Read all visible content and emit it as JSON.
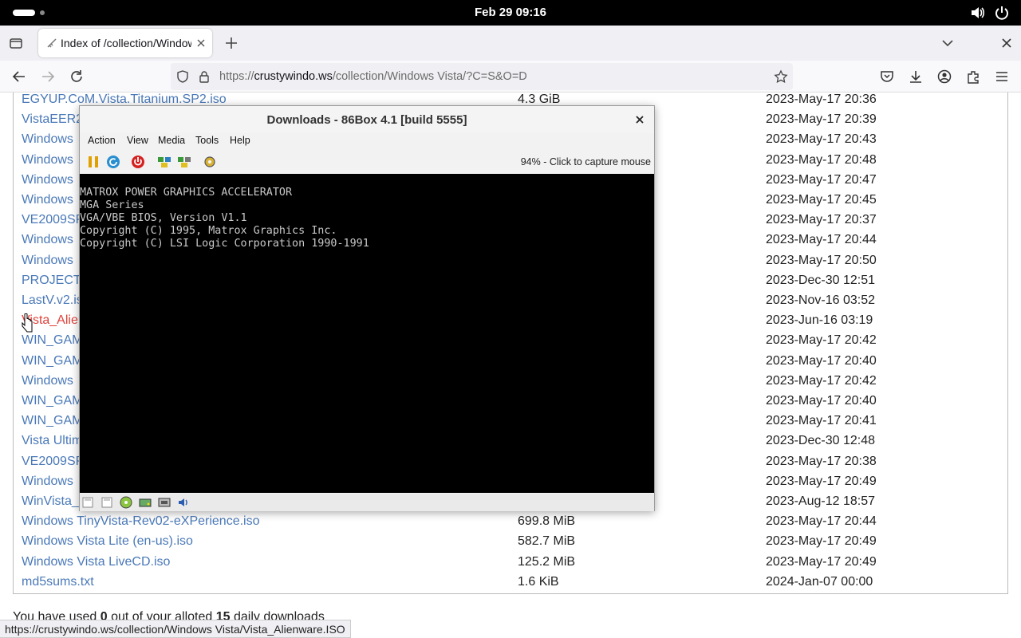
{
  "system": {
    "clock": "Feb 29  09:16"
  },
  "browser": {
    "tab_title": "Index of /collection/Windows Vista",
    "url": {
      "scheme_host_prefix": "https://",
      "host": "crustywindo.ws",
      "path": "/collection/Windows Vista/?C=S&O=D"
    },
    "status_url": "https://crustywindo.ws/collection/Windows Vista/Vista_Alienware.ISO"
  },
  "listing": {
    "rows": [
      {
        "name": "EGYUP.CoM.Vista.Titanium.SP2.iso",
        "size": "4.3 GiB",
        "date": "2023-May-17 20:36"
      },
      {
        "name": "VistaEER2",
        "size": "",
        "date": "2023-May-17 20:39"
      },
      {
        "name": "Windows",
        "size": "",
        "date": "2023-May-17 20:43"
      },
      {
        "name": "Windows",
        "size": "",
        "date": "2023-May-17 20:48"
      },
      {
        "name": "Windows",
        "size": "",
        "date": "2023-May-17 20:47"
      },
      {
        "name": "Windows",
        "size": "",
        "date": "2023-May-17 20:45"
      },
      {
        "name": "VE2009SP",
        "size": "",
        "date": "2023-May-17 20:37"
      },
      {
        "name": "Windows",
        "size": "",
        "date": "2023-May-17 20:44"
      },
      {
        "name": "Windows",
        "size": "",
        "date": "2023-May-17 20:50"
      },
      {
        "name": "PROJECT_",
        "size": "",
        "date": "2023-Dec-30 12:51"
      },
      {
        "name": "LastV.v2.is",
        "size": "",
        "date": "2023-Nov-16 03:52"
      },
      {
        "name": "Vista_Alienware",
        "size": "",
        "date": "2023-Jun-16 03:19",
        "hover": true
      },
      {
        "name": "WIN_GAM",
        "size": "",
        "date": "2023-May-17 20:42"
      },
      {
        "name": "WIN_GAM",
        "size": "",
        "date": "2023-May-17 20:40"
      },
      {
        "name": "Windows",
        "size": "",
        "date": "2023-May-17 20:42"
      },
      {
        "name": "WIN_GAM",
        "size": "",
        "date": "2023-May-17 20:40"
      },
      {
        "name": "WIN_GAM",
        "size": "",
        "date": "2023-May-17 20:41"
      },
      {
        "name": "Vista Ultim",
        "size": "",
        "date": "2023-Dec-30 12:48"
      },
      {
        "name": "VE2009SP",
        "size": "",
        "date": "2023-May-17 20:38"
      },
      {
        "name": "Windows",
        "size": "",
        "date": "2023-May-17 20:49"
      },
      {
        "name": "WinVista_",
        "size": "",
        "date": "2023-Aug-12 18:57"
      },
      {
        "name": "Windows TinyVista-Rev02-eXPerience.iso",
        "size": "699.8 MiB",
        "date": "2023-May-17 20:44"
      },
      {
        "name": "Windows Vista Lite (en-us).iso",
        "size": "582.7 MiB",
        "date": "2023-May-17 20:49"
      },
      {
        "name": "Windows Vista LiveCD.iso",
        "size": "125.2 MiB",
        "date": "2023-May-17 20:49"
      },
      {
        "name": "md5sums.txt",
        "size": "1.6 KiB",
        "date": "2024-Jan-07 00:00"
      }
    ],
    "usage": {
      "prefix": "You have used ",
      "used": "0",
      "middle": " out of your alloted ",
      "limit": "15",
      "suffix": " daily downloads"
    }
  },
  "vm": {
    "title": "Downloads - 86Box 4.1 [build 5555]",
    "menu": [
      "Action",
      "View",
      "Media",
      "Tools",
      "Help"
    ],
    "capture_text": "94% - Click to capture mouse",
    "bios_lines": [
      "MATROX POWER GRAPHICS ACCELERATOR",
      "MGA Series",
      "VGA/VBE BIOS, Version V1.1",
      "Copyright (C) 1995, Matrox Graphics Inc.",
      "Copyright (C) LSI Logic Corporation 1990-1991"
    ],
    "toolbar_icons": [
      "pause-icon",
      "reset-icon",
      "power-off-icon",
      "ctrl-alt-del-icon",
      "ctrl-alt-esc-icon",
      "settings-icon"
    ],
    "status_icons": [
      "floppy-1-icon",
      "floppy-2-icon",
      "cdrom-icon",
      "hard-disk-icon",
      "network-icon",
      "sound-icon"
    ]
  },
  "colors": {
    "link": "#4a79b8",
    "link_hover": "#e0413b",
    "terminal_text": "#c8c8c8"
  }
}
